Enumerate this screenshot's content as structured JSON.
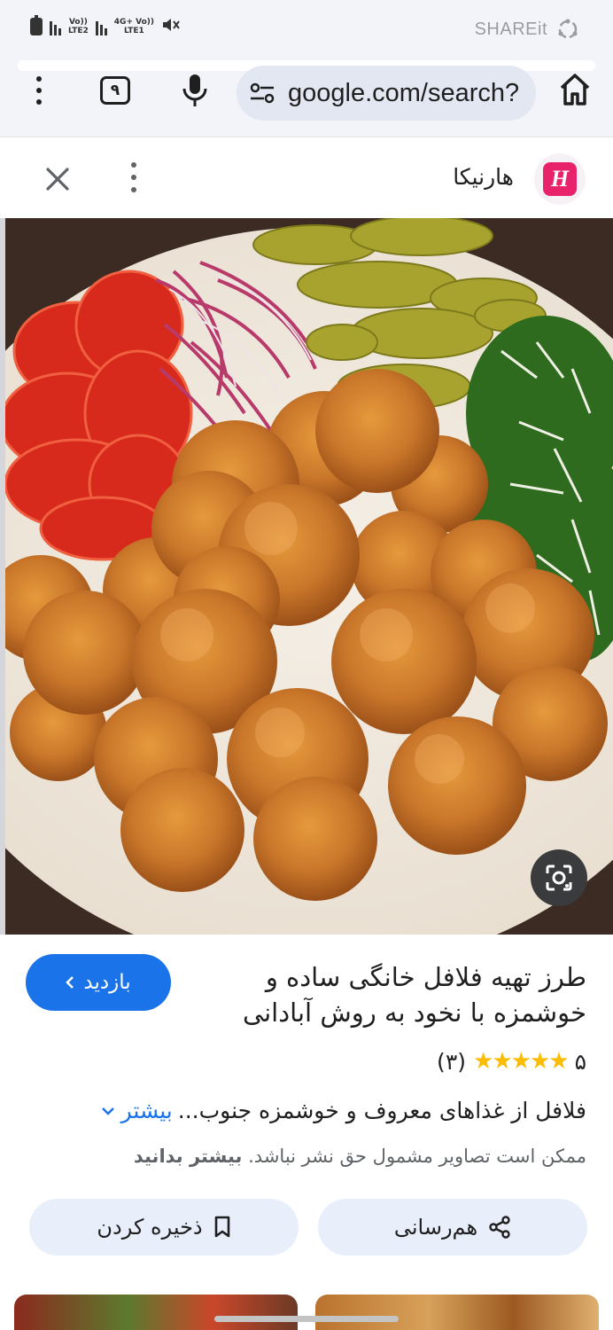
{
  "status_bar": {
    "net1_top": "Vo))",
    "net1_bottom": "LTE2",
    "net2_top": "4G+ Vo))",
    "net2_bottom": "LTE1",
    "shareit": "SHAREit"
  },
  "toolbar": {
    "tab_count": "۹",
    "url": "google.com/search?"
  },
  "panel": {
    "site_name": "هارنیکا",
    "logo_letter": "H"
  },
  "result": {
    "title": "طرز تهیه فلافل خانگی ساده و خوشمزه با نخود به روش آبادانی",
    "visit_label": "بازدید",
    "rating_value": "۵",
    "stars": "★★★★★",
    "rating_count": "(۳)",
    "description": "فلافل از غذاهای معروف و خوشمزه جنوب...",
    "more_label": "بیشتر",
    "copyright_text": "ممکن است تصاویر مشمول حق نشر نباشد.",
    "learn_more": "بیشتر بدانید",
    "share_label": "هم‌رسانی",
    "save_label": "ذخیره کردن"
  },
  "colors": {
    "accent": "#1a73e8",
    "star": "#fbbc04",
    "logo": "#e8226b",
    "chip_bg": "#e8eefa"
  }
}
